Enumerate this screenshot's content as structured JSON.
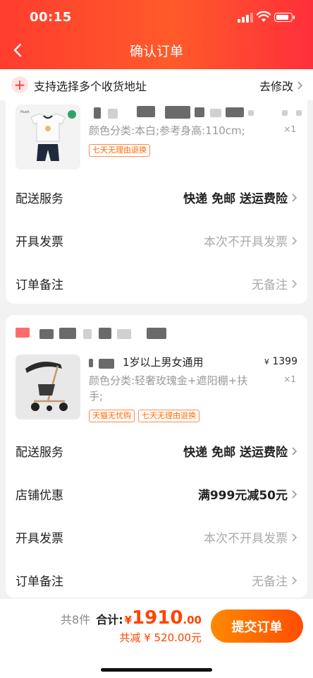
{
  "status_bar": {
    "time": "00:15"
  },
  "header": {
    "title": "确认订单"
  },
  "address_bar": {
    "text": "支持选择多个收货地址",
    "action": "去修改"
  },
  "orders": [
    {
      "item": {
        "spec": "颜色分类:本白;参考身高:110cm;",
        "qty": "×1",
        "tags": [
          "七天无理由退换"
        ]
      },
      "rows": [
        {
          "label": "配送服务",
          "value": "快递 免邮 送运费险"
        },
        {
          "label": "开具发票",
          "value": "本次不开具发票"
        },
        {
          "label": "订单备注",
          "value": "无备注"
        }
      ]
    },
    {
      "item": {
        "title_visible": "1岁以上男女通用",
        "price_currency": "¥",
        "price": "1399",
        "spec": "颜色分类:轻奢玫瑰金+遮阳棚+扶手;",
        "qty": "×1",
        "tags": [
          "天猫无忧购",
          "七天无理由退换"
        ]
      },
      "rows": [
        {
          "label": "配送服务",
          "value": "快递 免邮 送运费险"
        },
        {
          "label": "店铺优惠",
          "value": "满999元减50元"
        },
        {
          "label": "开具发票",
          "value": "本次不开具发票"
        },
        {
          "label": "订单备注",
          "value": "无备注"
        }
      ]
    }
  ],
  "footer": {
    "count": "共8件",
    "total_label": "合计:",
    "currency": "¥",
    "total_int": "1910",
    "total_dec": ".00",
    "discount": "共减 ¥ 520.00元",
    "submit": "提交订单"
  },
  "colors": {
    "accent": "#ff4400",
    "header": "#ff3d2e",
    "tag": "#ff6a00"
  }
}
